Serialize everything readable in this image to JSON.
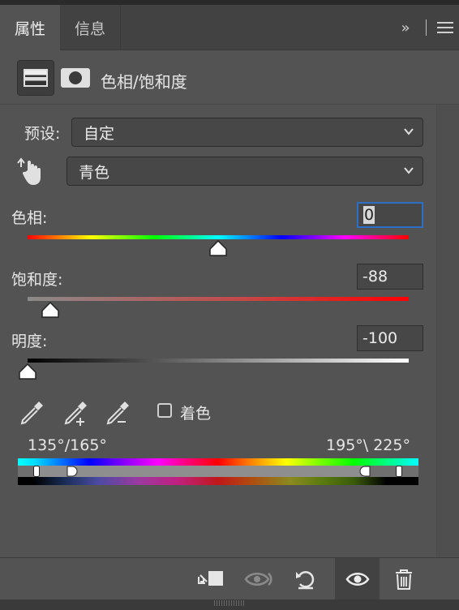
{
  "tabs": [
    {
      "label": "属性",
      "active": true
    },
    {
      "label": "信息",
      "active": false
    }
  ],
  "tabbar": {
    "collapse_glyph": "»",
    "menu_icon": "hamburger-menu-icon"
  },
  "header": {
    "title": "色相/饱和度",
    "buttons": [
      {
        "icon": "hue-saturation-adjustment-icon",
        "selected": true
      },
      {
        "icon": "layer-mask-icon",
        "selected": false
      }
    ]
  },
  "preset": {
    "label": "预设:",
    "value": "自定"
  },
  "channel": {
    "value": "青色",
    "icon": "targeted-adjustment-hand-icon"
  },
  "hue": {
    "label": "色相:",
    "value": "0",
    "slider_fraction": 0.5
  },
  "saturation": {
    "label": "饱和度:",
    "value": "-88",
    "slider_fraction": 0.06
  },
  "lightness": {
    "label": "明度:",
    "value": "-100",
    "slider_fraction": 0.0
  },
  "tools": [
    "eyedropper-icon",
    "eyedropper-plus-icon",
    "eyedropper-minus-icon"
  ],
  "colorize": {
    "label": "着色",
    "checked": false
  },
  "range": {
    "left": "135°/165°",
    "right": "195°\\ 225°"
  },
  "footer": {
    "buttons": [
      {
        "icon": "clip-to-layer-icon",
        "active": false,
        "enabled": true
      },
      {
        "icon": "view-previous-state-icon",
        "active": false,
        "enabled": false
      },
      {
        "icon": "reset-icon",
        "active": false,
        "enabled": true
      },
      {
        "icon": "eye-visibility-icon",
        "active": true,
        "enabled": true
      },
      {
        "icon": "trash-icon",
        "active": false,
        "enabled": true
      }
    ]
  },
  "colors": {
    "accent_focus": "#2d6fc4",
    "panel_bg": "#535353",
    "field_bg": "#474747"
  }
}
